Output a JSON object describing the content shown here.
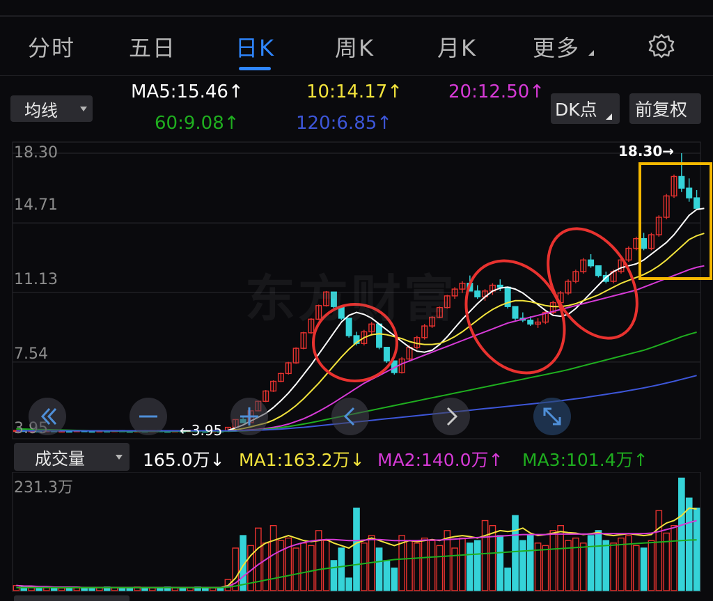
{
  "tabs": [
    {
      "label": "分时",
      "active": false
    },
    {
      "label": "五日",
      "active": false
    },
    {
      "label": "日K",
      "active": true
    },
    {
      "label": "周K",
      "active": false
    },
    {
      "label": "月K",
      "active": false
    },
    {
      "label": "更多",
      "active": false
    }
  ],
  "indicator_select": {
    "label": "均线"
  },
  "ma": {
    "ma5": "MA5:15.46",
    "ma10": "10:14.17",
    "ma20": "20:12.50",
    "ma60": "60:9.08",
    "ma120": "120:6.85",
    "arrow_up": "↑",
    "arrow_down": "↓"
  },
  "buttons": {
    "dk_point": "DK点",
    "adjust": "前复权"
  },
  "price_axis": [
    "18.30",
    "14.71",
    "11.13",
    "7.54",
    "3.95"
  ],
  "annotations": {
    "high": "18.30→",
    "low": "←3.95",
    "watermark": "东方财富"
  },
  "volume_header": {
    "select_label": "成交量",
    "current": "165.0万",
    "ma1": "MA1:163.2万",
    "ma2": "MA2:140.0万",
    "ma3": "MA3:101.4万"
  },
  "volume_axis_max": "231.3万",
  "colors": {
    "up": "#e8322f",
    "down": "#35d3d8",
    "ma5": "#ffffff",
    "ma10": "#f2e33c",
    "ma20": "#d63ad6",
    "ma60": "#1fae1f",
    "ma120": "#3d56d8",
    "accent": "#2f86ff",
    "highlight_box": "#f5b800",
    "circle": "#e8322f"
  },
  "icons": [
    "double-left-icon",
    "minus-icon",
    "left-icon",
    "right-icon",
    "expand-icon",
    "gear-icon"
  ],
  "chart_data": {
    "type": "candlestick",
    "y_range": [
      3.95,
      18.3
    ],
    "max_price": 18.3,
    "min_price": 3.95,
    "candles": [
      [
        4.0,
        4.05,
        3.95,
        4.02
      ],
      [
        4.02,
        4.05,
        3.96,
        3.98
      ],
      [
        3.98,
        4.02,
        3.95,
        4.0
      ],
      [
        4.0,
        4.04,
        3.96,
        3.97
      ],
      [
        3.97,
        4.02,
        3.95,
        4.01
      ],
      [
        4.01,
        4.03,
        3.95,
        3.96
      ],
      [
        3.96,
        4.0,
        3.95,
        3.99
      ],
      [
        3.99,
        4.03,
        3.96,
        3.98
      ],
      [
        3.98,
        4.02,
        3.95,
        4.01
      ],
      [
        4.01,
        4.04,
        3.97,
        3.99
      ],
      [
        3.99,
        4.02,
        3.95,
        3.97
      ],
      [
        3.97,
        4.01,
        3.95,
        4.0
      ],
      [
        4.0,
        4.03,
        3.96,
        3.98
      ],
      [
        3.98,
        4.02,
        3.95,
        4.01
      ],
      [
        4.01,
        4.04,
        3.96,
        3.99
      ],
      [
        3.99,
        4.02,
        3.95,
        3.97
      ],
      [
        3.97,
        4.01,
        3.95,
        4.0
      ],
      [
        4.0,
        4.03,
        3.96,
        3.98
      ],
      [
        3.98,
        4.02,
        3.95,
        4.01
      ],
      [
        4.01,
        4.04,
        3.97,
        3.99
      ],
      [
        3.99,
        4.02,
        3.95,
        3.97
      ],
      [
        3.97,
        4.01,
        3.95,
        4.0
      ],
      [
        4.0,
        4.03,
        3.96,
        3.98
      ],
      [
        3.98,
        4.02,
        3.95,
        4.01
      ],
      [
        4.01,
        4.04,
        3.96,
        3.99
      ],
      [
        3.99,
        4.02,
        3.95,
        3.97
      ],
      [
        3.97,
        4.01,
        3.95,
        4.0
      ],
      [
        4.0,
        4.03,
        3.96,
        3.98
      ],
      [
        3.98,
        4.2,
        3.95,
        4.18
      ],
      [
        4.18,
        4.6,
        4.15,
        4.58
      ],
      [
        4.58,
        4.75,
        4.4,
        4.42
      ],
      [
        4.42,
        5.05,
        4.4,
        5.03
      ],
      [
        5.03,
        5.55,
        5.0,
        5.52
      ],
      [
        5.52,
        6.1,
        5.48,
        6.05
      ],
      [
        6.05,
        6.6,
        6.0,
        6.55
      ],
      [
        6.55,
        7.0,
        6.5,
        6.95
      ],
      [
        6.95,
        7.55,
        6.9,
        7.5
      ],
      [
        7.5,
        8.3,
        7.45,
        8.25
      ],
      [
        8.25,
        9.1,
        8.2,
        9.05
      ],
      [
        9.05,
        9.8,
        9.0,
        9.75
      ],
      [
        9.75,
        10.5,
        9.7,
        10.45
      ],
      [
        10.45,
        11.2,
        10.4,
        11.15
      ],
      [
        11.15,
        10.5,
        10.3,
        10.4
      ],
      [
        10.4,
        9.85,
        9.7,
        9.8
      ],
      [
        9.8,
        9.3,
        8.8,
        8.9
      ],
      [
        8.9,
        9.1,
        8.4,
        8.5
      ],
      [
        8.5,
        9.2,
        8.4,
        9.1
      ],
      [
        9.1,
        9.6,
        8.9,
        9.5
      ],
      [
        9.5,
        9.3,
        8.2,
        8.3
      ],
      [
        8.3,
        7.6,
        7.5,
        7.6
      ],
      [
        7.6,
        7.4,
        6.9,
        7.0
      ],
      [
        7.0,
        7.8,
        6.95,
        7.7
      ],
      [
        7.7,
        8.4,
        7.6,
        8.3
      ],
      [
        8.3,
        8.9,
        8.2,
        8.8
      ],
      [
        8.8,
        9.5,
        8.7,
        9.4
      ],
      [
        9.4,
        9.9,
        9.3,
        9.85
      ],
      [
        9.85,
        10.4,
        9.8,
        10.35
      ],
      [
        10.35,
        11.0,
        10.3,
        10.95
      ],
      [
        10.95,
        11.4,
        10.8,
        11.3
      ],
      [
        11.3,
        11.7,
        11.1,
        11.6
      ],
      [
        11.6,
        12.0,
        11.4,
        11.2
      ],
      [
        11.2,
        11.5,
        10.8,
        10.9
      ],
      [
        10.9,
        11.3,
        10.7,
        11.2
      ],
      [
        11.2,
        11.6,
        11.0,
        11.5
      ],
      [
        11.5,
        11.8,
        11.2,
        11.4
      ],
      [
        11.4,
        11.1,
        10.3,
        10.4
      ],
      [
        10.4,
        10.3,
        9.7,
        9.8
      ],
      [
        9.8,
        10.1,
        9.6,
        9.7
      ],
      [
        9.7,
        9.9,
        9.4,
        9.5
      ],
      [
        9.5,
        9.8,
        9.3,
        9.6
      ],
      [
        9.6,
        10.2,
        9.5,
        10.1
      ],
      [
        10.1,
        10.7,
        10.0,
        10.6
      ],
      [
        10.6,
        11.2,
        10.5,
        11.1
      ],
      [
        11.1,
        11.8,
        11.0,
        11.7
      ],
      [
        11.7,
        12.3,
        11.6,
        12.2
      ],
      [
        12.2,
        12.9,
        12.1,
        12.8
      ],
      [
        12.8,
        13.1,
        12.4,
        12.5
      ],
      [
        12.5,
        12.4,
        11.9,
        12.0
      ],
      [
        12.0,
        12.2,
        11.6,
        11.7
      ],
      [
        11.7,
        12.3,
        11.6,
        12.2
      ],
      [
        12.2,
        12.9,
        12.1,
        12.8
      ],
      [
        12.8,
        13.5,
        12.7,
        13.4
      ],
      [
        13.4,
        14.0,
        13.3,
        13.9
      ],
      [
        13.9,
        14.2,
        13.3,
        13.4
      ],
      [
        13.4,
        14.2,
        13.3,
        14.1
      ],
      [
        14.1,
        15.1,
        14.0,
        15.0
      ],
      [
        15.0,
        16.2,
        14.9,
        16.1
      ],
      [
        16.1,
        17.2,
        16.0,
        17.1
      ],
      [
        17.1,
        18.3,
        16.3,
        16.5
      ],
      [
        16.5,
        17.0,
        15.8,
        16.0
      ],
      [
        16.0,
        16.4,
        15.5,
        15.46
      ]
    ],
    "ma_series": {
      "ma5": {
        "start": 28,
        "values": [
          4.02,
          4.15,
          4.3,
          4.5,
          4.7,
          4.9,
          5.2,
          5.55,
          5.95,
          6.4,
          6.9,
          7.4,
          7.95,
          8.5,
          9.05,
          9.6,
          9.95,
          10.1,
          10.0,
          9.8,
          9.5,
          9.2,
          8.9,
          8.6,
          8.3,
          8.1,
          8.05,
          8.15,
          8.45,
          8.85,
          9.3,
          9.75,
          10.15,
          10.55,
          10.9,
          11.2,
          11.35,
          11.4,
          11.3,
          11.1,
          10.8,
          10.5,
          10.2,
          9.95,
          9.9,
          10.0,
          10.3,
          10.7,
          11.1,
          11.5,
          11.9,
          12.2,
          12.4,
          12.5,
          12.6,
          12.8,
          13.1,
          13.4,
          13.7,
          14.1,
          14.6,
          15.1,
          15.4,
          15.46
        ]
      },
      "ma10": {
        "start": 28,
        "values": [
          4.0,
          4.05,
          4.12,
          4.2,
          4.3,
          4.4,
          4.55,
          4.75,
          5.0,
          5.3,
          5.65,
          6.05,
          6.45,
          6.9,
          7.35,
          7.8,
          8.2,
          8.55,
          8.8,
          8.95,
          9.0,
          8.95,
          8.85,
          8.75,
          8.6,
          8.5,
          8.45,
          8.45,
          8.5,
          8.65,
          8.85,
          9.1,
          9.4,
          9.7,
          10.0,
          10.25,
          10.45,
          10.6,
          10.7,
          10.7,
          10.65,
          10.55,
          10.45,
          10.4,
          10.4,
          10.45,
          10.55,
          10.7,
          10.85,
          11.0,
          11.2,
          11.4,
          11.6,
          11.75,
          11.9,
          12.05,
          12.25,
          12.5,
          12.8,
          13.15,
          13.5,
          13.85,
          14.05,
          14.17
        ]
      },
      "ma20": {
        "start": 28,
        "values": [
          3.98,
          4.0,
          4.02,
          4.05,
          4.08,
          4.12,
          4.18,
          4.25,
          4.35,
          4.48,
          4.62,
          4.8,
          5.0,
          5.22,
          5.45,
          5.7,
          5.95,
          6.2,
          6.45,
          6.65,
          6.85,
          7.05,
          7.25,
          7.45,
          7.6,
          7.75,
          7.9,
          8.05,
          8.2,
          8.35,
          8.5,
          8.65,
          8.8,
          8.95,
          9.1,
          9.25,
          9.4,
          9.55,
          9.65,
          9.75,
          9.85,
          9.95,
          10.05,
          10.15,
          10.25,
          10.35,
          10.45,
          10.55,
          10.65,
          10.75,
          10.85,
          10.95,
          11.05,
          11.15,
          11.25,
          11.4,
          11.55,
          11.7,
          11.85,
          12.0,
          12.15,
          12.3,
          12.42,
          12.5
        ]
      },
      "ma60": {
        "start": 0,
        "values": [
          4.1,
          4.09,
          4.08,
          4.07,
          4.06,
          4.05,
          4.04,
          4.03,
          4.02,
          4.01,
          4.0,
          4.0,
          3.99,
          3.99,
          3.98,
          3.98,
          3.98,
          3.98,
          3.98,
          3.98,
          3.98,
          3.98,
          3.98,
          3.98,
          3.98,
          3.98,
          3.98,
          3.98,
          3.98,
          3.99,
          4.0,
          4.02,
          4.05,
          4.08,
          4.12,
          4.17,
          4.22,
          4.28,
          4.35,
          4.42,
          4.5,
          4.58,
          4.66,
          4.74,
          4.82,
          4.9,
          4.98,
          5.06,
          5.14,
          5.22,
          5.3,
          5.38,
          5.46,
          5.54,
          5.62,
          5.7,
          5.78,
          5.86,
          5.94,
          6.02,
          6.1,
          6.18,
          6.26,
          6.34,
          6.42,
          6.5,
          6.58,
          6.66,
          6.74,
          6.82,
          6.9,
          6.98,
          7.06,
          7.15,
          7.25,
          7.35,
          7.45,
          7.55,
          7.65,
          7.75,
          7.85,
          7.95,
          8.05,
          8.15,
          8.28,
          8.42,
          8.56,
          8.7,
          8.85,
          8.97,
          9.08
        ]
      },
      "ma120": {
        "start": 0,
        "values": [
          4.0,
          4.0,
          4.0,
          4.0,
          4.0,
          4.0,
          4.0,
          4.0,
          4.0,
          4.0,
          4.0,
          4.0,
          4.0,
          4.0,
          4.0,
          4.0,
          4.0,
          4.0,
          4.0,
          4.0,
          4.0,
          4.0,
          4.0,
          4.0,
          4.0,
          4.0,
          4.0,
          4.0,
          4.0,
          4.0,
          4.01,
          4.02,
          4.03,
          4.05,
          4.07,
          4.09,
          4.12,
          4.15,
          4.18,
          4.22,
          4.26,
          4.3,
          4.34,
          4.38,
          4.42,
          4.46,
          4.5,
          4.54,
          4.58,
          4.62,
          4.66,
          4.7,
          4.74,
          4.78,
          4.82,
          4.86,
          4.9,
          4.94,
          4.98,
          5.02,
          5.06,
          5.1,
          5.14,
          5.18,
          5.22,
          5.26,
          5.3,
          5.34,
          5.38,
          5.42,
          5.46,
          5.5,
          5.55,
          5.6,
          5.65,
          5.7,
          5.76,
          5.82,
          5.88,
          5.94,
          6.0,
          6.07,
          6.14,
          6.21,
          6.29,
          6.37,
          6.46,
          6.55,
          6.65,
          6.75,
          6.85
        ]
      }
    },
    "volume_max": 231.3,
    "volume_unit": "万",
    "volumes": [
      10,
      8,
      7,
      6,
      7,
      6,
      5,
      6,
      7,
      6,
      5,
      6,
      7,
      6,
      5,
      6,
      7,
      6,
      5,
      6,
      7,
      6,
      5,
      6,
      7,
      6,
      5,
      6,
      22,
      85,
      110,
      90,
      125,
      95,
      130,
      100,
      105,
      85,
      95,
      90,
      120,
      100,
      60,
      85,
      25,
      165,
      95,
      110,
      85,
      60,
      45,
      110,
      100,
      95,
      105,
      100,
      90,
      120,
      85,
      105,
      95,
      100,
      140,
      130,
      110,
      45,
      150,
      100,
      110,
      95,
      90,
      120,
      130,
      100,
      105,
      95,
      110,
      120,
      100,
      95,
      105,
      110,
      90,
      85,
      100,
      160,
      115,
      130,
      225,
      185,
      165
    ],
    "volume_ma": {
      "ma1": [
        10,
        9,
        8,
        7,
        7,
        6,
        6,
        6,
        6,
        6,
        6,
        6,
        6,
        6,
        6,
        6,
        6,
        6,
        6,
        6,
        6,
        6,
        6,
        6,
        6,
        6,
        6,
        6,
        10,
        25,
        50,
        70,
        85,
        95,
        100,
        105,
        110,
        105,
        100,
        98,
        100,
        102,
        95,
        90,
        85,
        95,
        100,
        105,
        100,
        95,
        90,
        95,
        100,
        98,
        100,
        102,
        100,
        105,
        108,
        110,
        108,
        105,
        110,
        115,
        120,
        118,
        120,
        125,
        115,
        110,
        112,
        115,
        118,
        116,
        115,
        112,
        114,
        116,
        112,
        110,
        112,
        114,
        112,
        110,
        112,
        125,
        135,
        140,
        150,
        165,
        163.2
      ],
      "ma2": [
        10,
        9,
        9,
        8,
        8,
        7,
        7,
        7,
        7,
        6,
        6,
        6,
        6,
        6,
        6,
        6,
        6,
        6,
        6,
        6,
        6,
        6,
        6,
        6,
        6,
        6,
        6,
        6,
        8,
        15,
        28,
        40,
        52,
        62,
        72,
        80,
        87,
        92,
        96,
        99,
        101,
        102,
        102,
        101,
        100,
        100,
        101,
        102,
        102,
        101,
        100,
        100,
        100,
        100,
        101,
        101,
        101,
        102,
        103,
        104,
        105,
        106,
        107,
        108,
        109,
        110,
        111,
        112,
        112,
        112,
        112,
        113,
        113,
        113,
        113,
        113,
        113,
        114,
        114,
        114,
        114,
        114,
        114,
        114,
        115,
        118,
        122,
        126,
        131,
        136,
        140.0
      ],
      "ma3": [
        6,
        6,
        6,
        6,
        6,
        6,
        6,
        6,
        6,
        6,
        6,
        6,
        6,
        6,
        6,
        6,
        6,
        6,
        6,
        6,
        6,
        6,
        6,
        6,
        6,
        6,
        6,
        6,
        7,
        9,
        12,
        15,
        18,
        21,
        24,
        27,
        30,
        33,
        36,
        39,
        42,
        44,
        46,
        48,
        50,
        52,
        54,
        56,
        58,
        60,
        62,
        63,
        64,
        65,
        66,
        67,
        68,
        69,
        70,
        71,
        72,
        73,
        74,
        75,
        76,
        77,
        78,
        79,
        80,
        81,
        82,
        83,
        84,
        85,
        86,
        87,
        88,
        89,
        90,
        91,
        92,
        93,
        94,
        95,
        96,
        97,
        98,
        99,
        100,
        101,
        101.4
      ]
    }
  }
}
